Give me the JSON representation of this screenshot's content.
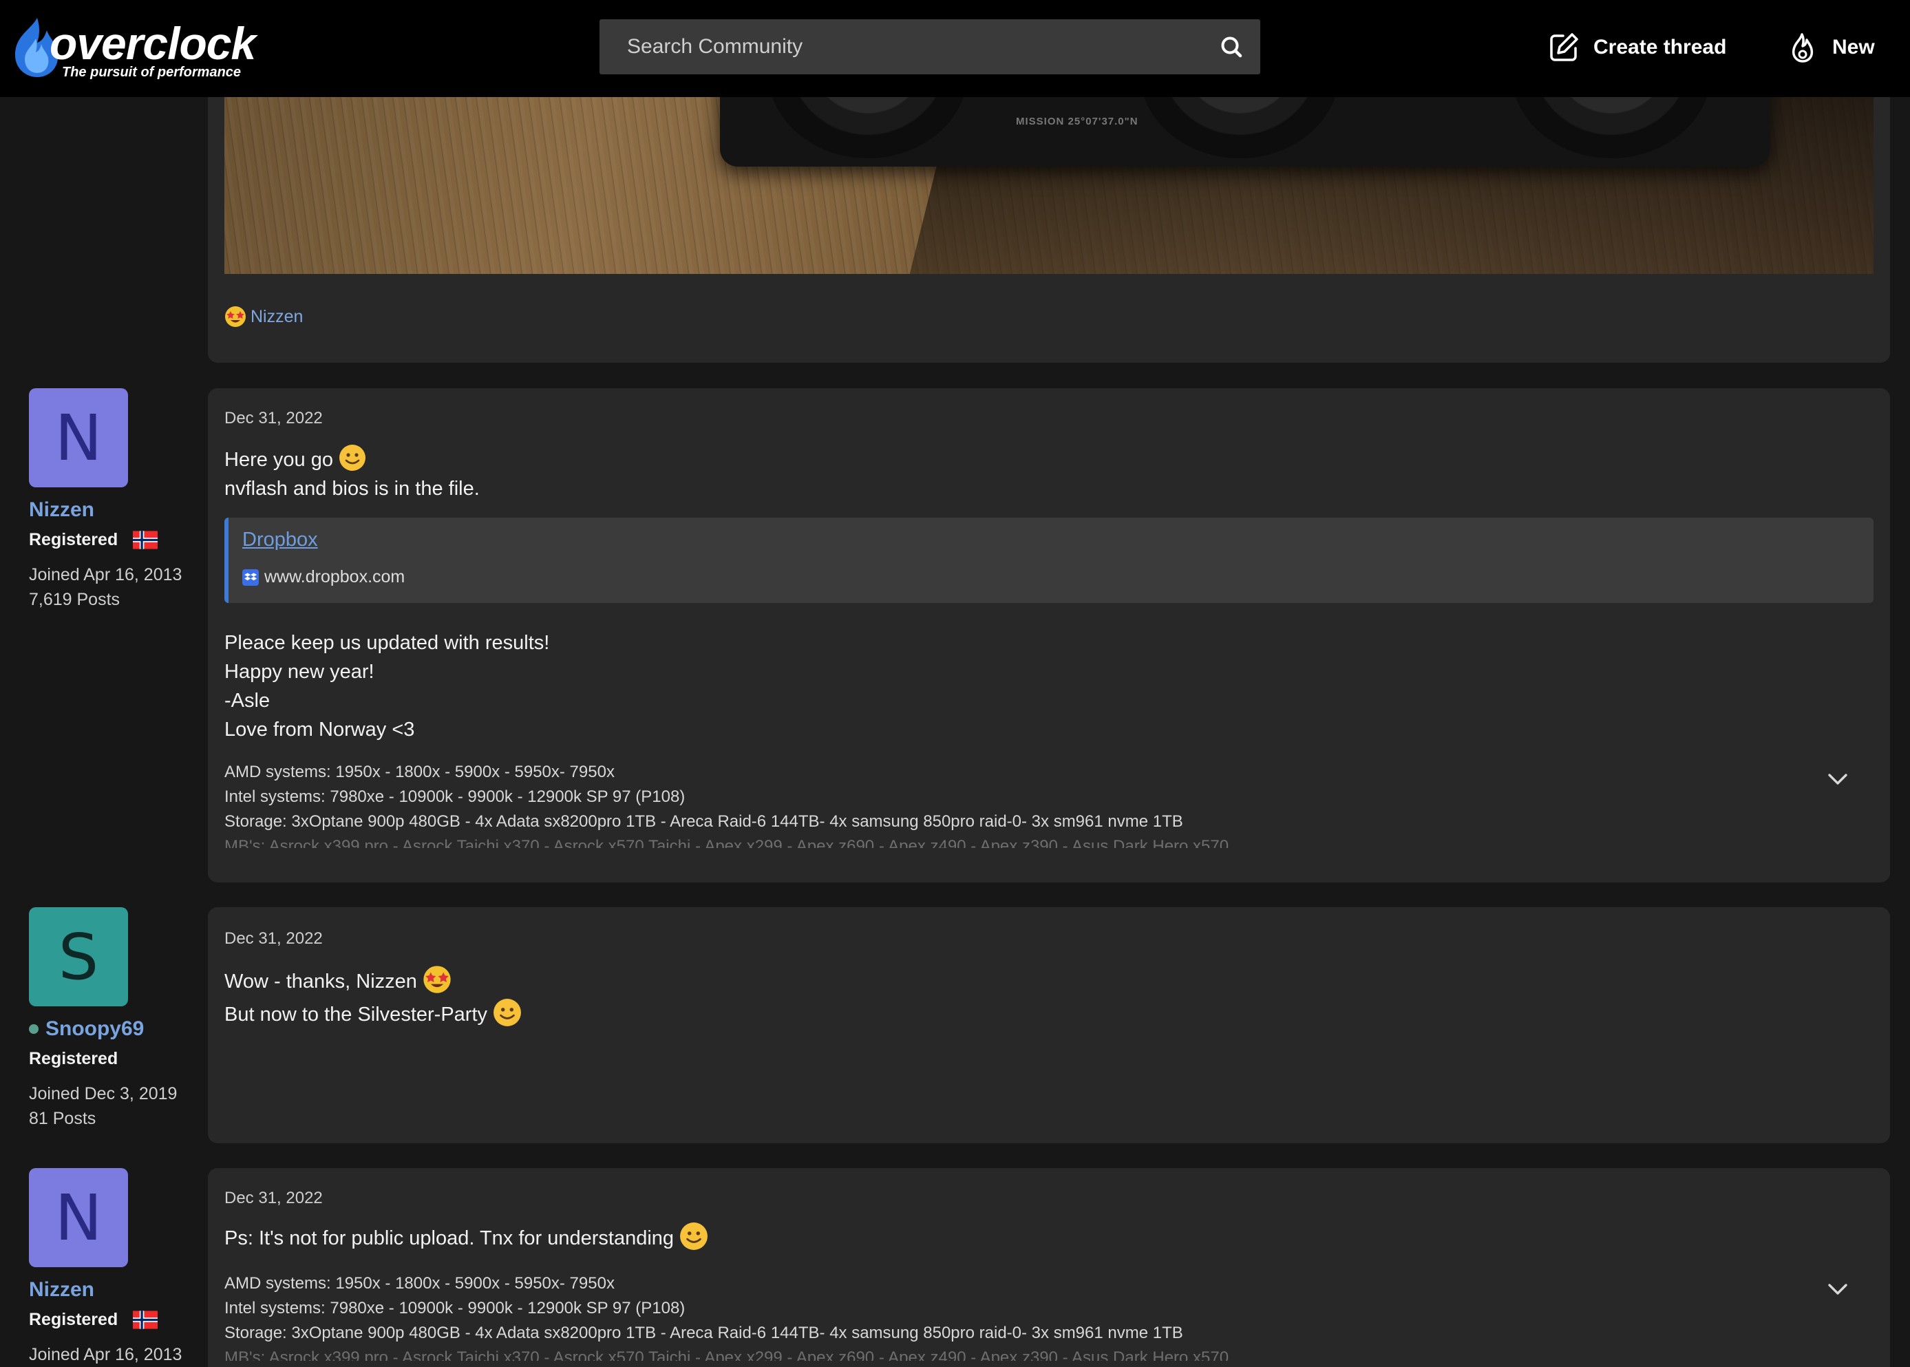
{
  "header": {
    "logo_word": "overclock",
    "tagline": "The pursuit of performance",
    "search_placeholder": "Search Community",
    "create_thread": "Create thread",
    "new": "New"
  },
  "colors": {
    "accent": "#79a4df",
    "link": "#6f9ee0",
    "card": "#282828",
    "background": "#171717"
  },
  "top_post": {
    "image_label": "MISSION 25°07'37.0\"N",
    "reaction_user": "Nizzen",
    "reaction_icon": "star-struck-emoji-icon"
  },
  "signature_lines": [
    "AMD systems: 1950x - 1800x - 5900x - 5950x- 7950x",
    "Intel systems: 7980xe - 10900k - 9900k - 12900k SP 97 (P108)",
    "Storage: 3xOptane 900p 480GB - 4x Adata sx8200pro 1TB - Areca Raid-6 144TB- 4x samsung 850pro raid-0- 3x sm961 nvme 1TB",
    "MB's: Asrock x399 pro - Asrock Taichi x370 - Asrock x570 Taichi - Apex x299 - Apex z690 - Apex z490 - Apex z390 - Asus Dark Hero x570"
  ],
  "posts": [
    {
      "author": {
        "initial": "N",
        "name": "Nizzen",
        "role": "Registered",
        "joined": "Joined Apr 16, 2013",
        "posts": "7,619 Posts"
      },
      "date": "Dec 31, 2022",
      "line1": "Here you go",
      "line2": "nvflash and bios is in the file.",
      "link": {
        "title": "Dropbox",
        "url": "www.dropbox.com"
      },
      "lines": [
        "Pleace keep us updated with results!",
        "Happy new year!",
        "-Asle",
        "Love from Norway <3"
      ]
    },
    {
      "author": {
        "initial": "S",
        "name": "Snoopy69",
        "role": "Registered",
        "joined": "Joined Dec 3, 2019",
        "posts": "81 Posts"
      },
      "date": "Dec 31, 2022",
      "line1": "Wow - thanks, Nizzen",
      "line2": "But now to the Silvester-Party"
    },
    {
      "author": {
        "initial": "N",
        "name": "Nizzen",
        "role": "Registered",
        "joined": "Joined Apr 16, 2013"
      },
      "date": "Dec 31, 2022",
      "line1": "Ps: It's not for public upload. Tnx for understanding"
    }
  ]
}
